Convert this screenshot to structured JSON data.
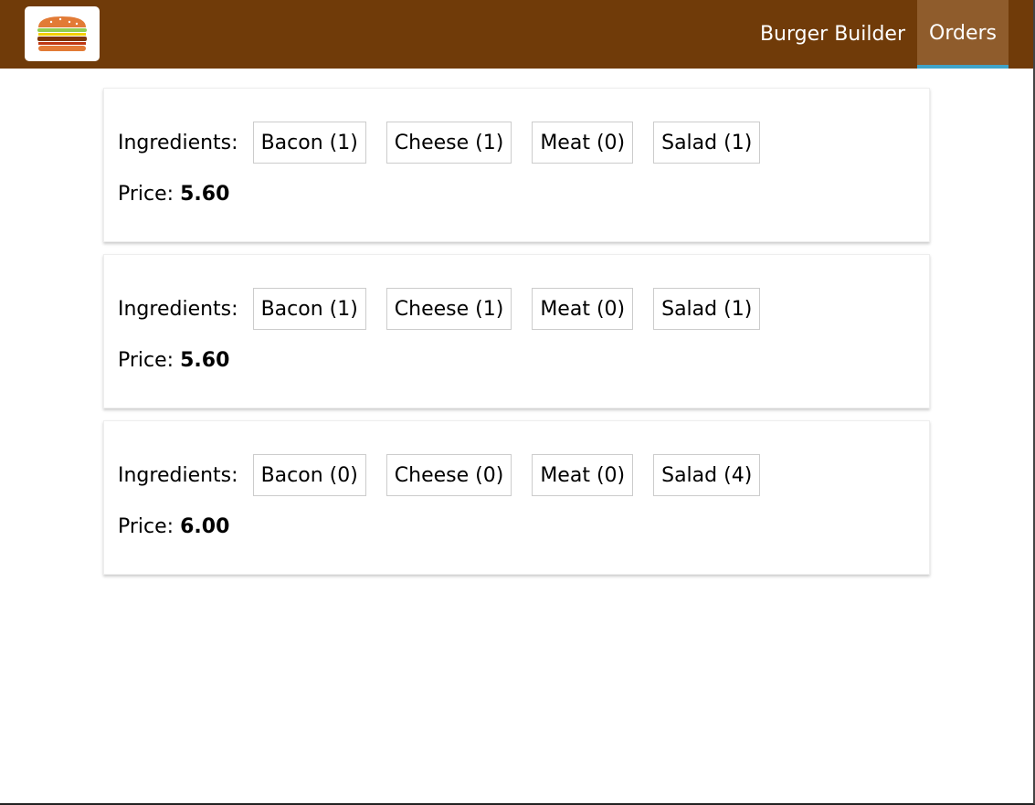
{
  "header": {
    "logo_icon": "burger-logo-icon",
    "nav": [
      {
        "label": "Burger Builder",
        "active": false
      },
      {
        "label": "Orders",
        "active": true
      }
    ]
  },
  "orders": [
    {
      "ingredients_label": "Ingredients:",
      "ingredients": [
        "Bacon (1)",
        "Cheese (1)",
        "Meat (0)",
        "Salad (1)"
      ],
      "price_label": "Price:",
      "price": "5.60"
    },
    {
      "ingredients_label": "Ingredients:",
      "ingredients": [
        "Bacon (1)",
        "Cheese (1)",
        "Meat (0)",
        "Salad (1)"
      ],
      "price_label": "Price:",
      "price": "5.60"
    },
    {
      "ingredients_label": "Ingredients:",
      "ingredients": [
        "Bacon (0)",
        "Cheese (0)",
        "Meat (0)",
        "Salad (4)"
      ],
      "price_label": "Price:",
      "price": "6.00"
    }
  ],
  "colors": {
    "toolbar": "#703b09",
    "active_nav": "#8f5c2c",
    "active_underline": "#40a4c8"
  }
}
